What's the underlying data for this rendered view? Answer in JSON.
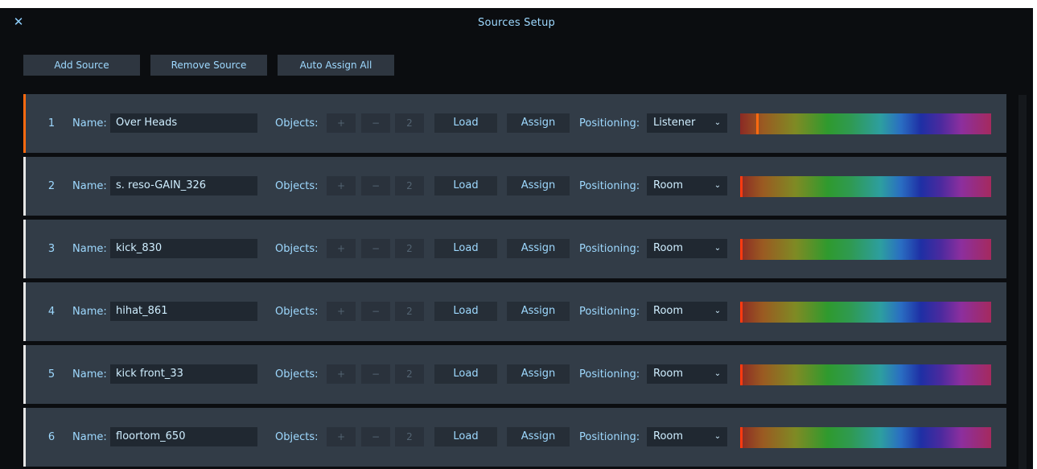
{
  "window": {
    "title": "Sources Setup",
    "close_icon": "close-icon",
    "close_glyph": "✕"
  },
  "toolbar": {
    "add_label": "Add Source",
    "remove_label": "Remove Source",
    "auto_assign_label": "Auto Assign All"
  },
  "labels": {
    "name": "Name:",
    "objects": "Objects:",
    "plus": "+",
    "minus": "−",
    "load": "Load",
    "assign": "Assign",
    "positioning": "Positioning:",
    "chevron_glyph": "⌄"
  },
  "colors": {
    "accent_blue": "#9ed9ff",
    "active_indicator": "#ff6a10",
    "row_bg": "#323c47",
    "window_bg": "#0b0d10"
  },
  "sources": [
    {
      "number": "1",
      "name": "Over Heads",
      "objects": "2",
      "positioning": "Listener",
      "active": true,
      "color_position": 0.065
    },
    {
      "number": "2",
      "name": "s. reso-GAIN_326",
      "objects": "2",
      "positioning": "Room",
      "active": false,
      "color_position": 0.0
    },
    {
      "number": "3",
      "name": "kick_830",
      "objects": "2",
      "positioning": "Room",
      "active": false,
      "color_position": 0.0
    },
    {
      "number": "4",
      "name": "hihat_861",
      "objects": "2",
      "positioning": "Room",
      "active": false,
      "color_position": 0.0
    },
    {
      "number": "5",
      "name": "kick front_33",
      "objects": "2",
      "positioning": "Room",
      "active": false,
      "color_position": 0.0
    },
    {
      "number": "6",
      "name": "floortom_650",
      "objects": "2",
      "positioning": "Room",
      "active": false,
      "color_position": 0.0
    }
  ]
}
